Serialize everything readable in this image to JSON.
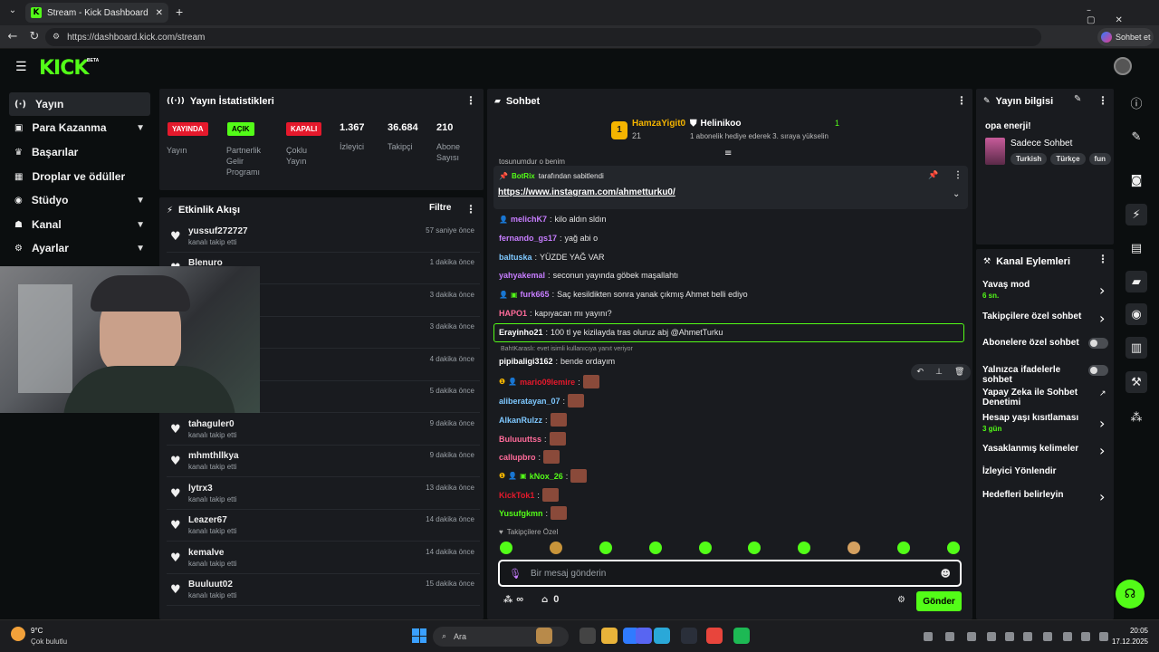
{
  "browser": {
    "tab_title": "Stream - Kick Dashboard",
    "url": "https://dashboard.kick.com/stream",
    "chat_button": "Sohbet et"
  },
  "header": {
    "logo": "KICK",
    "beta": "BETA"
  },
  "sidebar": {
    "items": [
      {
        "label": "Yayın",
        "icon": "broadcast-icon"
      },
      {
        "label": "Para Kazanma",
        "icon": "money-icon"
      },
      {
        "label": "Başarılar",
        "icon": "trophy-icon"
      },
      {
        "label": "Droplar ve ödüller",
        "icon": "gift-icon"
      },
      {
        "label": "Stüdyo",
        "icon": "studio-icon"
      },
      {
        "label": "Kanal",
        "icon": "channel-icon"
      },
      {
        "label": "Ayarlar",
        "icon": "gear-icon"
      }
    ]
  },
  "stats": {
    "title": "Yayın İstatistikleri",
    "badges": [
      {
        "badge": "YAYINDA",
        "label": "Yayın",
        "color": "#e5192c"
      },
      {
        "badge": "AÇIK",
        "label": "Partnerlik Gelir Programı",
        "color": "#53fc18"
      },
      {
        "badge": "KAPALI",
        "label": "Çoklu Yayın",
        "color": "#e5192c"
      }
    ],
    "numbers": [
      {
        "value": "1.367",
        "label": "İzleyici"
      },
      {
        "value": "36.684",
        "label": "Takipçi"
      },
      {
        "value": "210",
        "label": "Abone Sayısı"
      }
    ]
  },
  "activity": {
    "title": "Etkinlik Akışı",
    "filter": "Filtre",
    "rows": [
      {
        "name": "yussuf272727",
        "sub": "kanalı takip etti",
        "time": "57 saniye önce"
      },
      {
        "name": "Blenuro",
        "sub": "kanalı takip etti",
        "time": "1 dakika önce"
      },
      {
        "name": "",
        "sub": "",
        "time": "3 dakika önce"
      },
      {
        "name": "",
        "sub": "",
        "time": "3 dakika önce"
      },
      {
        "name": "",
        "sub": "",
        "time": "4 dakika önce"
      },
      {
        "name": "",
        "sub": "",
        "time": "5 dakika önce"
      },
      {
        "name": "tahaguler0",
        "sub": "kanalı takip etti",
        "time": "9 dakika önce"
      },
      {
        "name": "mhmthllkya",
        "sub": "kanalı takip etti",
        "time": "9 dakika önce"
      },
      {
        "name": "lytrx3",
        "sub": "kanalı takip etti",
        "time": "13 dakika önce"
      },
      {
        "name": "Leazer67",
        "sub": "kanalı takip etti",
        "time": "14 dakika önce"
      },
      {
        "name": "kemalve",
        "sub": "kanalı takip etti",
        "time": "14 dakika önce"
      },
      {
        "name": "Buuluut02",
        "sub": "kanalı takip etti",
        "time": "15 dakika önce"
      }
    ]
  },
  "chat": {
    "title": "Sohbet",
    "gifter": {
      "name": "HamzaYigit0",
      "count": "21",
      "rank": "1"
    },
    "gifted": {
      "name": "Helinikoo",
      "count": "1",
      "message": "1 abonelik hediye ederek 3. sıraya yükselin"
    },
    "partial_line": "tosunumdur o benim",
    "pinned": {
      "by": "BotRix",
      "text": "tarafından sabitlendi",
      "link": "https://www.instagram.com/ahmetturku0/"
    },
    "messages": [
      {
        "user": "melichK7",
        "text": "kilo aldın sldın",
        "color": "#c77dff"
      },
      {
        "user": "fernando_gs17",
        "text": "yağ abi o",
        "color": "#c77dff"
      },
      {
        "user": "baltuska",
        "text": "YÜZDE YAĞ VAR",
        "color": "#7ec8ff"
      },
      {
        "user": "yahyakemal",
        "text": "seconun yayında göbek maşallahtı",
        "color": "#c77dff"
      },
      {
        "user": "furk665",
        "text": "Saç kesildikten sonra yanak çıkmış Ahmet belli ediyo",
        "color": "#c77dff"
      },
      {
        "user": "HAPO1",
        "text": "kapıyacan mı yayını?",
        "color": "#ff6b9a"
      },
      {
        "user": "Erayinho21",
        "text": "100 tl ye kizilayda tras oluruz abj @AhmetTurku",
        "color": "#ffffff"
      },
      {
        "user": "pipibaligi3162",
        "text": "bende ordayım",
        "color": "#ffffff"
      },
      {
        "user": "mario09lemire",
        "text": "",
        "color": "#e5192c"
      },
      {
        "user": "aliberatayan_07",
        "text": "",
        "color": "#7ec8ff"
      },
      {
        "user": "AlkanRulzz",
        "text": "",
        "color": "#7ec8ff"
      },
      {
        "user": "Buluuuttss",
        "text": "",
        "color": "#ff6b9a"
      },
      {
        "user": "callupbro",
        "text": "",
        "color": "#ff6b9a"
      },
      {
        "user": "kNox_26",
        "text": "",
        "color": "#53fc18"
      },
      {
        "user": "KickTok1",
        "text": "",
        "color": "#e5192c"
      },
      {
        "user": "Yusufgkmn",
        "text": "",
        "color": "#53fc18"
      }
    ],
    "reply_hint": "BahtKaraslı: evet isimli kullanıcıya yanıt veriyor",
    "followers_only": "Takipçilere Özel",
    "input_placeholder": "Bir mesaj gönderin",
    "infinity": "∞",
    "store_count": "0",
    "send": "Gönder"
  },
  "stream_info": {
    "title": "Yayın bilgisi",
    "stream_title": "opa enerji!",
    "category": "Sadece Sohbet",
    "tags": [
      "Turkish",
      "Türkçe",
      "fun"
    ]
  },
  "channel_actions": {
    "title": "Kanal Eylemleri",
    "items": [
      {
        "label": "Yavaş mod",
        "sub": "6 sn.",
        "control": "chevron"
      },
      {
        "label": "Takipçilere özel sohbet",
        "sub": "",
        "control": "chevron"
      },
      {
        "label": "Abonelere özel sohbet",
        "sub": "",
        "control": "toggle"
      },
      {
        "label": "Yalnızca ifadelerle sohbet",
        "sub": "",
        "control": "toggle"
      },
      {
        "label": "Yapay Zeka ile Sohbet Denetimi",
        "sub": "",
        "control": "external"
      },
      {
        "label": "Hesap yaşı kısıtlaması",
        "sub": "3 gün",
        "control": "chevron"
      },
      {
        "label": "Yasaklanmış kelimeler",
        "sub": "",
        "control": "chevron"
      },
      {
        "label": "İzleyici Yönlendir",
        "sub": "",
        "control": "none"
      },
      {
        "label": "Hedefleri belirleyin",
        "sub": "",
        "control": "chevron"
      }
    ]
  },
  "taskbar": {
    "temp": "9°C",
    "weather": "Çok bulutlu",
    "search": "Ara",
    "time": "20:05",
    "date": "17.12.2025"
  }
}
